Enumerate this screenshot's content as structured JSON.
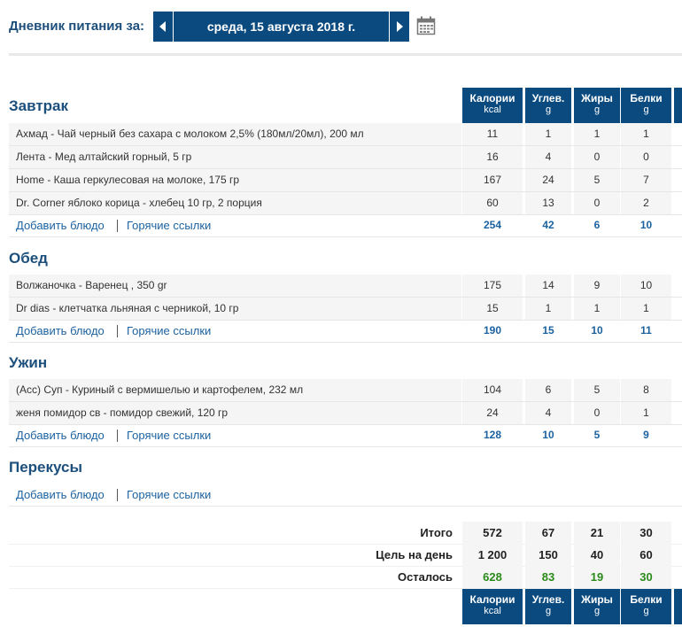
{
  "header": {
    "label": "Дневник питания за:",
    "date": "среда, 15 августа 2018 г."
  },
  "columns": [
    {
      "name": "Калории",
      "unit": "kcal"
    },
    {
      "name": "Углев.",
      "unit": "g"
    },
    {
      "name": "Жиры",
      "unit": "g"
    },
    {
      "name": "Белки",
      "unit": "g"
    }
  ],
  "links": {
    "add": "Добавить блюдо",
    "quick": "Горячие ссылки"
  },
  "meals": [
    {
      "title": "Завтрак",
      "items": [
        {
          "name": "Ахмад - Чай черный без сахара с молоком 2,5% (180мл/20мл), 200 мл",
          "values": [
            "11",
            "1",
            "1",
            "1"
          ]
        },
        {
          "name": "Лента - Мед алтайский горный, 5 гр",
          "values": [
            "16",
            "4",
            "0",
            "0"
          ]
        },
        {
          "name": "Home - Каша геркулесовая на молоке, 175 гр",
          "values": [
            "167",
            "24",
            "5",
            "7"
          ]
        },
        {
          "name": "Dr. Corner яблоко корица - хлебец 10 гр, 2 порция",
          "values": [
            "60",
            "13",
            "0",
            "2"
          ]
        }
      ],
      "totals": [
        "254",
        "42",
        "6",
        "10"
      ]
    },
    {
      "title": "Обед",
      "items": [
        {
          "name": "Волжаночка - Варенец , 350 gr",
          "values": [
            "175",
            "14",
            "9",
            "10"
          ]
        },
        {
          "name": "Dr dias - клетчатка льняная с черникой, 10 гр",
          "values": [
            "15",
            "1",
            "1",
            "1"
          ]
        }
      ],
      "totals": [
        "190",
        "15",
        "10",
        "11"
      ]
    },
    {
      "title": "Ужин",
      "items": [
        {
          "name": "(Асс) Суп - Куриный с вермишелью и картофелем, 232 мл",
          "values": [
            "104",
            "6",
            "5",
            "8"
          ]
        },
        {
          "name": "женя помидор св - помидор свежий, 120 гр",
          "values": [
            "24",
            "4",
            "0",
            "1"
          ]
        }
      ],
      "totals": [
        "128",
        "10",
        "5",
        "9"
      ]
    },
    {
      "title": "Перекусы",
      "items": [],
      "totals": []
    }
  ],
  "summary": [
    {
      "label": "Итого",
      "values": [
        "572",
        "67",
        "21",
        "30"
      ],
      "color": "#222222"
    },
    {
      "label": "Цель на день",
      "values": [
        "1 200",
        "150",
        "40",
        "60"
      ],
      "color": "#222222"
    },
    {
      "label": "Осталось",
      "values": [
        "628",
        "83",
        "19",
        "30"
      ],
      "color": "#2a8a1a"
    }
  ],
  "icons": {
    "prev": "arrow-left-icon",
    "next": "arrow-right-icon",
    "calendar": "calendar-icon"
  },
  "colors": {
    "brand": "#0a4a7f",
    "link": "#1c62a0",
    "title": "#1c4f7c",
    "remaining": "#2a8a1a"
  }
}
